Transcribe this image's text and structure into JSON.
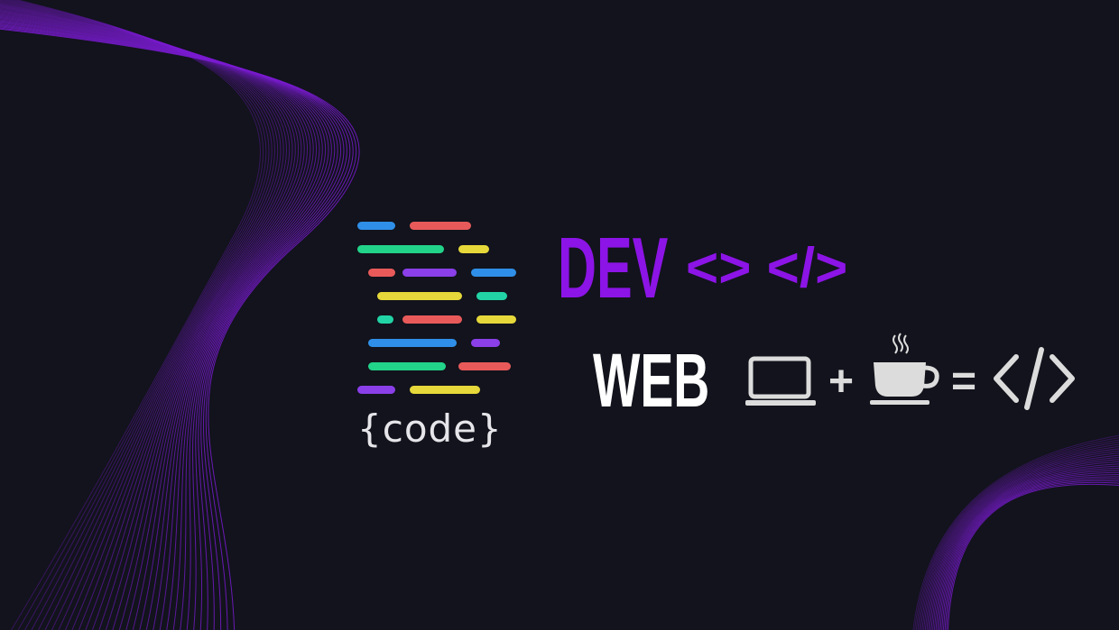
{
  "logo": {
    "word": "{code}",
    "bars": [
      {
        "color": "#2f8fe8"
      },
      {
        "color": "#e85a5a"
      },
      {
        "color": "#22d38a"
      },
      {
        "color": "#e6d83a"
      },
      {
        "color": "#e85a5a"
      },
      {
        "color": "#8a3fe8"
      },
      {
        "color": "#2f8fe8"
      },
      {
        "color": "#e6d83a"
      },
      {
        "color": "#22d3a6"
      },
      {
        "color": "#22d3a6"
      },
      {
        "color": "#e85a5a"
      },
      {
        "color": "#e6d83a"
      },
      {
        "color": "#2f8fe8"
      },
      {
        "color": "#8a3fe8"
      },
      {
        "color": "#22d38a"
      },
      {
        "color": "#e85a5a"
      },
      {
        "color": "#8a3fe8"
      },
      {
        "color": "#e6d83a"
      }
    ]
  },
  "headline": {
    "dev": "DEV",
    "dev_tags": "<> </>",
    "web": "WEB"
  },
  "equation": {
    "plus": "+",
    "equals": "=",
    "icons": [
      "laptop-icon",
      "coffee-cup-icon",
      "code-tag-icon"
    ]
  },
  "colors": {
    "background": "#12131c",
    "accent": "#8c14e6",
    "waves": "#7a1bd1"
  }
}
